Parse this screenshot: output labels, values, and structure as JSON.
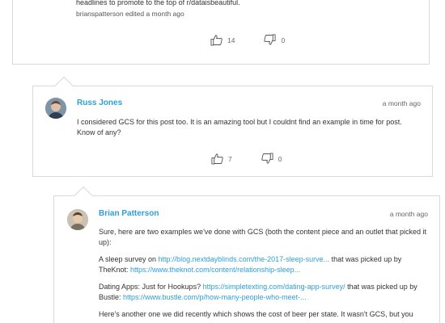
{
  "comment1": {
    "text": "headlines to promote to the top of r/dataisbeautiful.",
    "edited": "brianspatterson edited a month ago",
    "likes": "14",
    "dislikes": "0"
  },
  "comment2": {
    "author": "Russ Jones",
    "time": "a month ago",
    "text": "I considered GCS for this post too. It is an amazing tool but I couldnt find an example in time for post. Know of any?",
    "likes": "7",
    "dislikes": "0"
  },
  "comment3": {
    "author": "Brian Patterson",
    "time": "a month ago",
    "p1": "Sure, here are two examples we've done with GCS (both the content piece and an outlet that picked it up):",
    "p2_prefix": "A sleep survey on ",
    "p2_link1": "http://blog.nextdayblinds.com/the-2017-sleep-surve...",
    "p2_mid": " that was picked up by TheKnot: ",
    "p2_link2": "https://www.theknot.com/content/relationship-sleep...",
    "p3_prefix": "Dating Apps: Just for Hookups? ",
    "p3_link1": "https://simpletexting.com/dating-app-survey/",
    "p3_mid": " that was picked up by Bustle: ",
    "p3_link2": "https://www.bustle.com/p/how-many-people-who-meet-...",
    "p4": "Here's another one we did recently which shows the cost of beer per state. It wasn't GCS, but you"
  },
  "colors": {
    "link": "#2d9fd8",
    "border": "#d9d9d9"
  },
  "icons": {
    "like": "thumbs-up-icon",
    "dislike": "thumbs-down-icon"
  }
}
